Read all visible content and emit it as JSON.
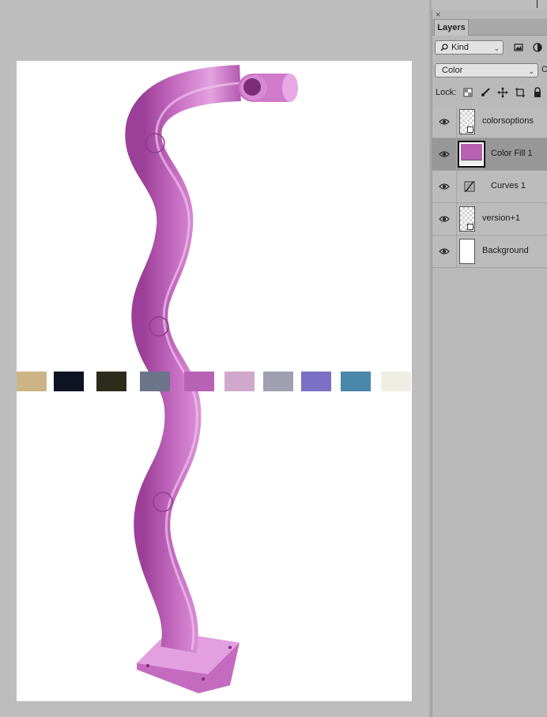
{
  "panel": {
    "close_glyph": "×",
    "tab_label": "Layers",
    "filter": {
      "selected": "Kind",
      "search_icon": "magnifier-icon"
    },
    "blend_mode": {
      "selected": "Color"
    },
    "opacity_label_partial": "O",
    "lock_label": "Lock:"
  },
  "layers": [
    {
      "name": "colorsoptions",
      "visible": true,
      "type": "smart-object",
      "selected": false
    },
    {
      "name": "Color Fill 1",
      "visible": true,
      "type": "fill",
      "fill_color": "#b760b4",
      "selected": true
    },
    {
      "name": "Curves 1",
      "visible": true,
      "type": "adjustment",
      "selected": false
    },
    {
      "name": "version+1",
      "visible": true,
      "type": "smart-object",
      "selected": false
    },
    {
      "name": "Background",
      "visible": true,
      "type": "background",
      "selected": false
    }
  ],
  "swatches": [
    "#cdb486",
    "#0d1322",
    "#2d2b1b",
    "#6b7488",
    "#b862b6",
    "#d0a8cb",
    "#9fa1b1",
    "#7c6fc6",
    "#4a87ab",
    "#efeee5"
  ],
  "product_color": "#c86fc4"
}
